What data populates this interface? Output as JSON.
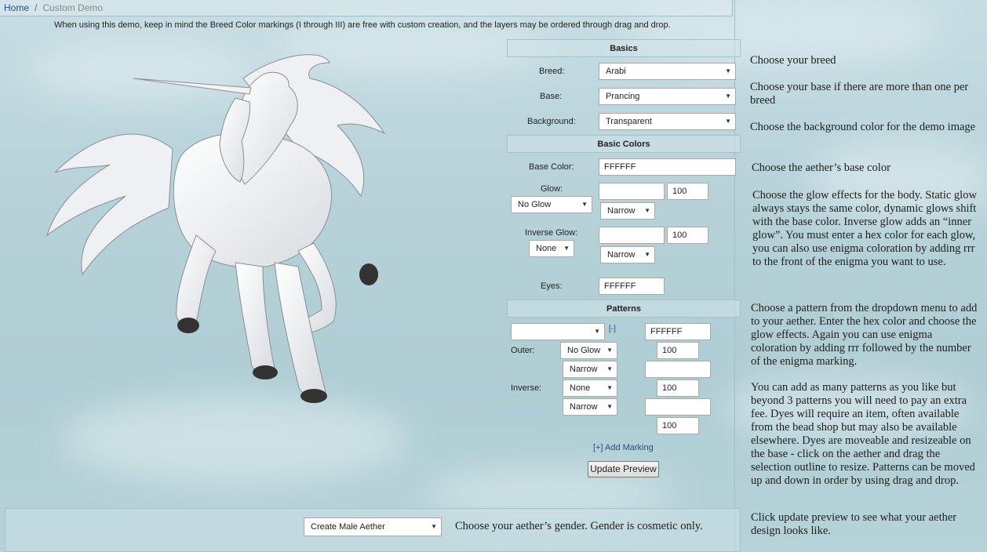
{
  "breadcrumb": {
    "home": "Home",
    "separator": "/",
    "current": "Custom Demo"
  },
  "notice": "When using this demo, keep in mind the Breed Color markings (I through III) are free with custom creation, and the layers may be ordered through drag and drop.",
  "basics": {
    "heading": "Basics",
    "breed_label": "Breed:",
    "breed_value": "Arabi",
    "base_label": "Base:",
    "base_value": "Prancing",
    "background_label": "Background:",
    "background_value": "Transparent"
  },
  "basic_colors": {
    "heading": "Basic Colors",
    "base_color_label": "Base Color:",
    "base_color_value": "FFFFFF",
    "glow_label": "Glow:",
    "glow_type": "No Glow",
    "glow_color": "",
    "glow_opacity": "100",
    "glow_width": "Narrow",
    "inverse_label": "Inverse Glow:",
    "inverse_type": "None",
    "inverse_color": "",
    "inverse_opacity": "100",
    "inverse_width": "Narrow",
    "eyes_label": "Eyes:",
    "eyes_value": "FFFFFF"
  },
  "patterns": {
    "heading": "Patterns",
    "pattern_select": "",
    "remove_link": "[-]",
    "color_value": "FFFFFF",
    "outer_label": "Outer:",
    "outer_type": "No Glow",
    "outer_opacity": "100",
    "outer_width": "Narrow",
    "outer_color": "",
    "inverse_label": "Inverse:",
    "inverse_type": "None",
    "inverse_opacity": "100",
    "inverse_width": "Narrow",
    "inverse_color": "",
    "final_opacity": "100",
    "add_link": "[+] Add Marking"
  },
  "update_button": "Update Preview",
  "gender": {
    "value": "Create Male Aether",
    "note": "Choose your aether’s gender.  Gender is cosmetic only."
  },
  "guide": {
    "breed": "Choose your breed",
    "base": "Choose your base if there are more than one per breed",
    "background": "Choose the background color for the demo  image",
    "base_color": "Choose the aether’s base color",
    "glow": "Choose the glow effects for the body.  Static glow always stays the same color, dynamic glows shift with the base color.  Inverse glow adds an “inner glow”.  You must enter a hex color for each glow, you can also use enigma coloration by adding rrr to the front of the enigma you want to use.",
    "pattern": "Choose a pattern from the dropdown menu to add to your aether.  Enter the hex color and choose the glow effects.  Again you can use enigma coloration by adding rrr followed by the number of the enigma  marking.",
    "more": "You can add as many patterns as you like but beyond 3 patterns you will need to pay an extra fee.  Dyes will require an item, often available from the bead shop but may also be available elsewhere.  Dyes are moveable and resizeable on the base - click on the aether and drag the selection outline to resize.  Patterns can be moved up and down in order by using drag and drop.",
    "update": "Click update preview to see what your aether design looks like."
  },
  "colors": {
    "link": "#1f4f8f",
    "background": "#b7d2d9"
  },
  "icons": {
    "dropdown": "chevron-down-icon"
  }
}
